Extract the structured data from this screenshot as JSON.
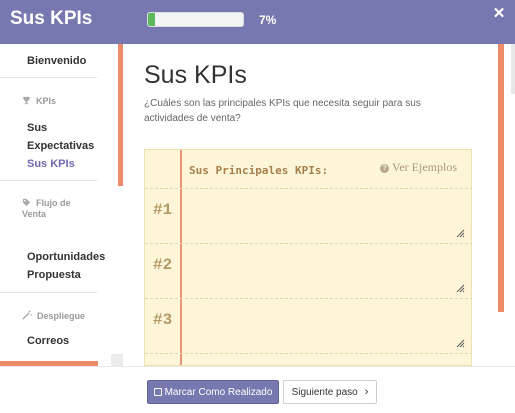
{
  "header": {
    "title": "Sus KPIs",
    "progress_fraction": 0.07,
    "progress_label": "7%",
    "close_icon": "close-icon"
  },
  "sidebar": {
    "items": [
      {
        "label": "Bienvenido"
      },
      {
        "label": "Sus Expectativas"
      },
      {
        "label": "Sus KPIs",
        "active": true
      },
      {
        "label": "Oportunidades"
      },
      {
        "label": "Propuesta"
      },
      {
        "label": "Correos"
      }
    ],
    "sections": [
      {
        "label": "KPIs",
        "icon": "trophy-icon"
      },
      {
        "label": "Flujo de Venta",
        "icon": "tag-icon"
      },
      {
        "label": "Despliegue",
        "icon": "magic-wand-icon"
      }
    ]
  },
  "main": {
    "title": "Sus KPIs",
    "subtitle": "¿Cuáles son las principales KPIs que necesita seguir para sus actividades de venta?",
    "notebook": {
      "header": "Sus Principales KPIs:",
      "examples_link": "Ver Ejemplos",
      "rows": [
        {
          "number": "#1",
          "value": ""
        },
        {
          "number": "#2",
          "value": ""
        },
        {
          "number": "#3",
          "value": ""
        }
      ]
    }
  },
  "footer": {
    "mark_done_label": "Marcar Como Realizado",
    "next_label": "Siguiente paso",
    "next_icon": "chevron-right-icon"
  },
  "colors": {
    "header_bg": "#7878b0",
    "accent_orange": "#ec8c68",
    "progress_green": "#5cb85c",
    "active_link": "#6f68b0",
    "notebook_bg": "#fdf5d8"
  }
}
